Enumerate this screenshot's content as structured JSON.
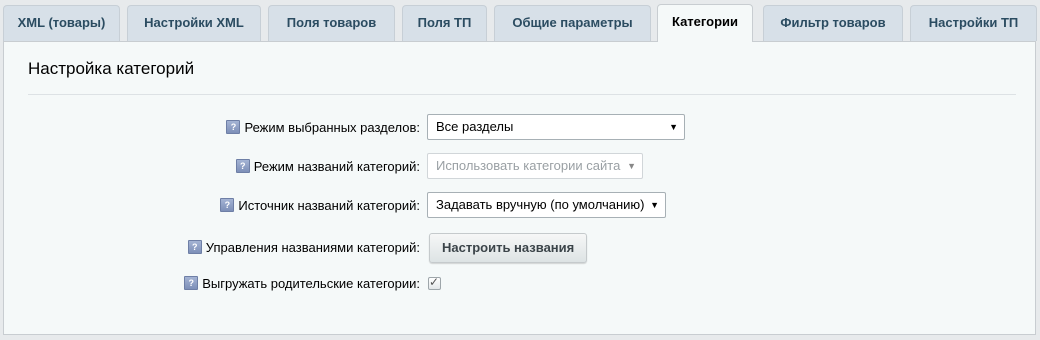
{
  "tabs": [
    {
      "label": "XML (товары)",
      "active": false
    },
    {
      "label": "Настройки XML",
      "active": false
    },
    {
      "label": "Поля товаров",
      "active": false
    },
    {
      "label": "Поля ТП",
      "active": false
    },
    {
      "label": "Общие параметры",
      "active": false
    },
    {
      "label": "Категории",
      "active": true
    },
    {
      "label": "Фильтр товаров",
      "active": false
    },
    {
      "label": "Настройки ТП",
      "active": false
    }
  ],
  "panel": {
    "title": "Настройка категорий"
  },
  "form": {
    "help_icon": "?",
    "sections_mode": {
      "label": "Режим выбранных разделов:",
      "value": "Все разделы"
    },
    "names_mode": {
      "label": "Режим названий категорий:",
      "value": "Использовать категории сайта",
      "disabled": true
    },
    "names_source": {
      "label": "Источник названий категорий:",
      "value": "Задавать вручную (по умолчанию)"
    },
    "names_manage": {
      "label": "Управления названиями категорий:",
      "button_label": "Настроить названия"
    },
    "export_parents": {
      "label": "Выгружать родительские категории:",
      "checked": true
    }
  },
  "icons": {
    "dropdown": "chevron-down-icon",
    "help": "help-icon",
    "check": "check-icon"
  }
}
